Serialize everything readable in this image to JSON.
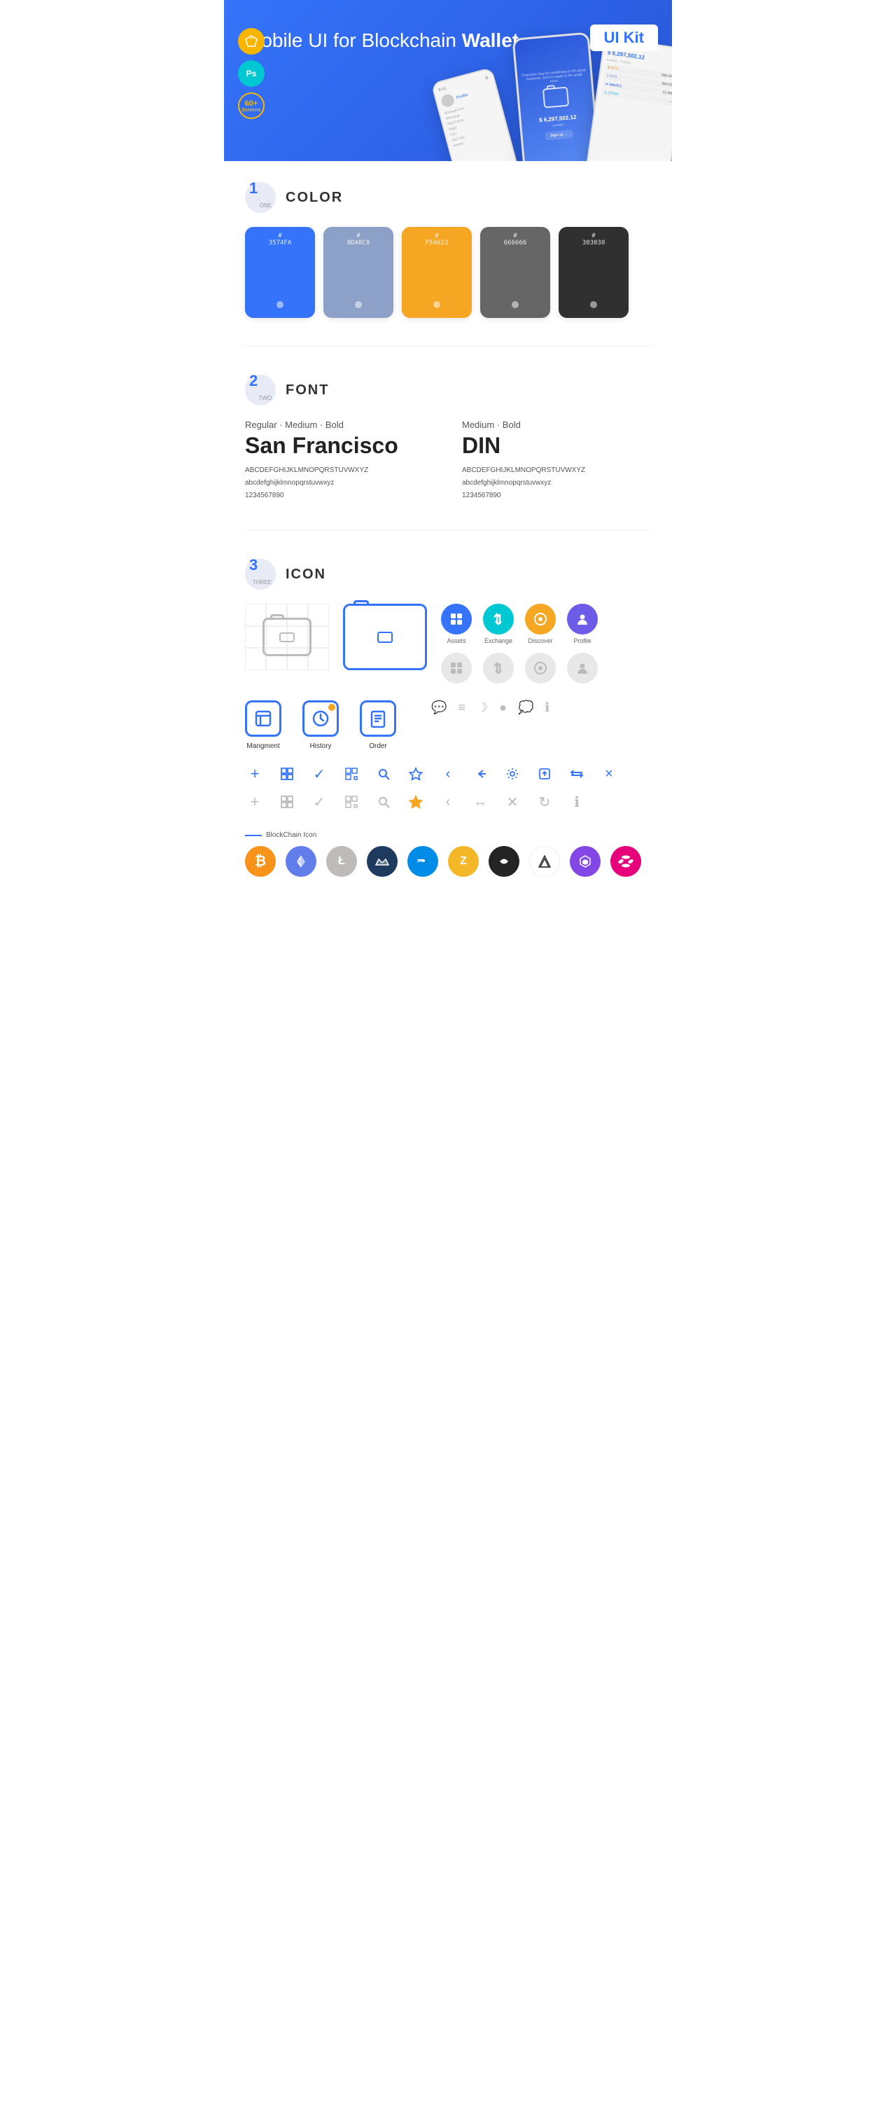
{
  "hero": {
    "title": "Mobile UI for Blockchain ",
    "title_bold": "Wallet",
    "ui_kit_badge": "UI Kit",
    "badges": [
      {
        "id": "sketch",
        "label": "S",
        "sub": ""
      },
      {
        "id": "ps",
        "label": "Ps",
        "sub": ""
      },
      {
        "id": "screens",
        "label": "60+",
        "sub": "Screens"
      }
    ]
  },
  "sections": {
    "color": {
      "number": "1",
      "sub": "ONE",
      "title": "COLOR",
      "swatches": [
        {
          "hex": "#3574FA",
          "label": "3574FA"
        },
        {
          "hex": "#8DA0C8",
          "label": "8DA0C8"
        },
        {
          "hex": "#F5A623",
          "label": "F5A623"
        },
        {
          "hex": "#666666",
          "label": "666666"
        },
        {
          "hex": "#303030",
          "label": "303030"
        }
      ]
    },
    "font": {
      "number": "2",
      "sub": "TWO",
      "title": "FONT",
      "fonts": [
        {
          "style": "Regular · Medium · Bold",
          "name": "San Francisco",
          "uppercase": "ABCDEFGHIJKLMNOPQRSTUVWXYZ",
          "lowercase": "abcdefghijklmnopqrstuvwxyz",
          "numbers": "1234567890"
        },
        {
          "style": "Medium · Bold",
          "name": "DIN",
          "uppercase": "ABCDEFGHIJKLMNOPQRSTUVWXYZ",
          "lowercase": "abcdefghijklmnopqrstuvwxyz",
          "numbers": "1234567890"
        }
      ]
    },
    "icon": {
      "number": "3",
      "sub": "THREE",
      "title": "ICON",
      "nav_icons": [
        {
          "label": "Assets",
          "color": "blue"
        },
        {
          "label": "Exchange",
          "color": "teal"
        },
        {
          "label": "Discover",
          "color": "orange"
        },
        {
          "label": "Profile",
          "color": "purple"
        }
      ],
      "app_icons": [
        {
          "label": "Mangment"
        },
        {
          "label": "History"
        },
        {
          "label": "Order"
        }
      ],
      "toolbar_icons": [
        "+",
        "⊞",
        "✓",
        "⊡",
        "🔍",
        "☆",
        "‹",
        "⇆",
        "⚙",
        "⊡",
        "⇔",
        "×"
      ],
      "blockchain_label": "BlockChain Icon",
      "crypto_icons": [
        {
          "symbol": "₿",
          "name": "Bitcoin",
          "class": "crypto-btc"
        },
        {
          "symbol": "Ξ",
          "name": "Ethereum",
          "class": "crypto-eth"
        },
        {
          "symbol": "Ł",
          "name": "Litecoin",
          "class": "crypto-ltc"
        },
        {
          "symbol": "◈",
          "name": "Waves",
          "class": "crypto-waves"
        },
        {
          "symbol": "Đ",
          "name": "Dash",
          "class": "crypto-dash"
        },
        {
          "symbol": "ⓩ",
          "name": "Zcash",
          "class": "crypto-zcash"
        },
        {
          "symbol": "◆",
          "name": "IOTA",
          "class": "crypto-iota"
        },
        {
          "symbol": "⬡",
          "name": "ARK",
          "class": "crypto-ark"
        },
        {
          "symbol": "▲",
          "name": "MATIC",
          "class": "crypto-matic"
        },
        {
          "symbol": "●",
          "name": "DOT",
          "class": "crypto-dot"
        }
      ]
    }
  }
}
